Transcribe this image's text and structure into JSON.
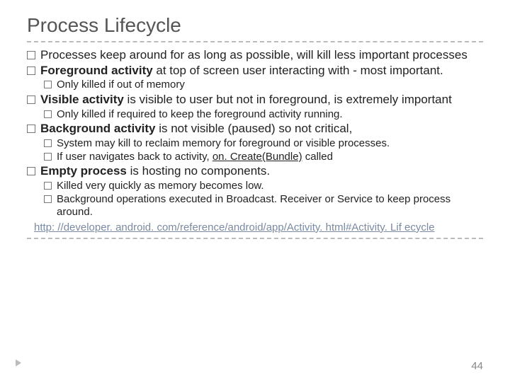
{
  "title": "Process Lifecycle",
  "b1a": "Processes keep around for as long as possible, will kill less important processes",
  "b1b_pre": "Foreground activity",
  "b1b_post": " at top of screen user interacting with - most important.",
  "b1b_s1": "Only killed if out of memory",
  "b2_pre": "Visible activity",
  "b2_post": " is visible to user but not in foreground, is extremely important",
  "b2_s1": "Only killed if required to keep the foreground activity running.",
  "b3_pre": "Background activity",
  "b3_post": " is not visible (paused) so not critical,",
  "b3_s1": "System may kill to reclaim memory for foreground or visible processes.",
  "b3_s2a": "If user navigates back to activity, ",
  "b3_s2_link": "on. Create(Bundle)",
  "b3_s2b": " called",
  "b4_pre": "Empty process",
  "b4_post": " is hosting no components.",
  "b4_s1": "Killed very quickly as memory becomes low.",
  "b4_s2": "Background operations executed in Broadcast. Receiver or Service to keep process around.",
  "url": "http: //developer. android. com/reference/android/app/Activity. html#Activity. Lif ecycle",
  "page": "44"
}
